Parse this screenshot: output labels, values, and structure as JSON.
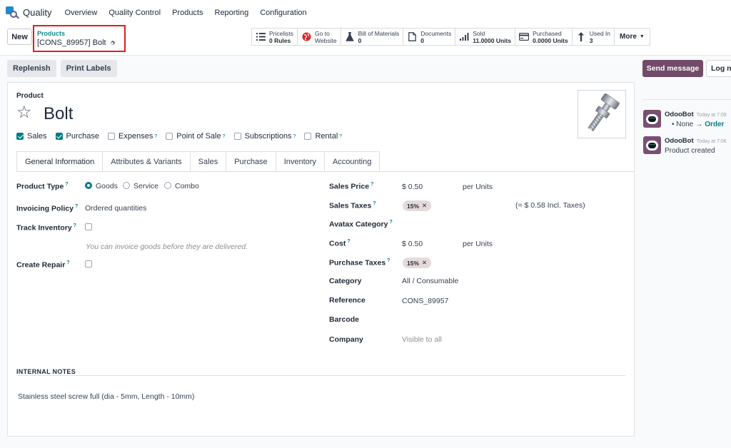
{
  "topnav": {
    "app_name": "Quality",
    "menu": [
      "Overview",
      "Quality Control",
      "Products",
      "Reporting",
      "Configuration"
    ]
  },
  "control": {
    "new_label": "New",
    "breadcrumb_parent": "Products",
    "breadcrumb_current": "[CONS_89957] Bolt",
    "stats": [
      {
        "icon": "list-icon",
        "label": "Pricelists",
        "value": "0 Rules"
      },
      {
        "icon": "globe-icon",
        "label": "Go to",
        "value": "Website"
      },
      {
        "icon": "flask-icon",
        "label": "Bill of Materials",
        "value": "0"
      },
      {
        "icon": "document-icon",
        "label": "Documents",
        "value": "0"
      },
      {
        "icon": "bar-chart-icon",
        "label": "Sold",
        "value": "11.0000 Units"
      },
      {
        "icon": "credit-card-icon",
        "label": "Purchased",
        "value": "0.0000 Units"
      },
      {
        "icon": "level-up-icon",
        "label": "Used In",
        "value": "3"
      }
    ],
    "more_label": "More"
  },
  "actions": {
    "replenish": "Replenish",
    "print_labels": "Print Labels"
  },
  "form": {
    "product_label": "Product",
    "name": "Bolt",
    "flags": [
      {
        "label": "Sales",
        "checked": true,
        "help": false
      },
      {
        "label": "Purchase",
        "checked": true,
        "help": false
      },
      {
        "label": "Expenses",
        "checked": false,
        "help": true
      },
      {
        "label": "Point of Sale",
        "checked": false,
        "help": true
      },
      {
        "label": "Subscriptions",
        "checked": false,
        "help": true
      },
      {
        "label": "Rental",
        "checked": false,
        "help": true
      }
    ],
    "tabs": [
      "General Information",
      "Attributes & Variants",
      "Sales",
      "Purchase",
      "Inventory",
      "Accounting"
    ],
    "active_tab": "General Information",
    "left": {
      "product_type_label": "Product Type",
      "product_type_options": [
        "Goods",
        "Service",
        "Combo"
      ],
      "product_type_selected": "Goods",
      "invoicing_policy_label": "Invoicing Policy",
      "invoicing_policy_value": "Ordered quantities",
      "track_inventory_label": "Track Inventory",
      "track_inventory_checked": false,
      "hint": "You can invoice goods before they are delivered.",
      "create_repair_label": "Create Repair",
      "create_repair_checked": false
    },
    "right": {
      "sales_price_label": "Sales Price",
      "sales_price_value": "$ 0.50",
      "sales_price_unit": "per Units",
      "sales_taxes_label": "Sales Taxes",
      "sales_taxes_tag": "15%",
      "sales_taxes_incl": "(= $ 0.58 Incl. Taxes)",
      "avatax_label": "Avatax Category",
      "cost_label": "Cost",
      "cost_value": "$ 0.50",
      "cost_unit": "per Units",
      "purchase_taxes_label": "Purchase Taxes",
      "purchase_taxes_tag": "15%",
      "category_label": "Category",
      "category_value": "All / Consumable",
      "reference_label": "Reference",
      "reference_value": "CONS_89957",
      "barcode_label": "Barcode",
      "company_label": "Company",
      "company_placeholder": "Visible to all"
    },
    "notes_heading": "INTERNAL NOTES",
    "notes_body": "Stainless steel screw full (dia - 5mm, Length - 10mm)"
  },
  "chatter": {
    "send_message": "Send message",
    "log_note": "Log note",
    "messages": [
      {
        "author": "OdooBot",
        "time": "Today at 7:09",
        "old_value": "None",
        "arrow": "→",
        "new_value": "Order"
      },
      {
        "author": "OdooBot",
        "time": "Today at 7:06",
        "body": "Product created"
      }
    ]
  },
  "colors": {
    "accent": "#017e84",
    "primary": "#714b67",
    "highlight": "#e11d1d"
  }
}
